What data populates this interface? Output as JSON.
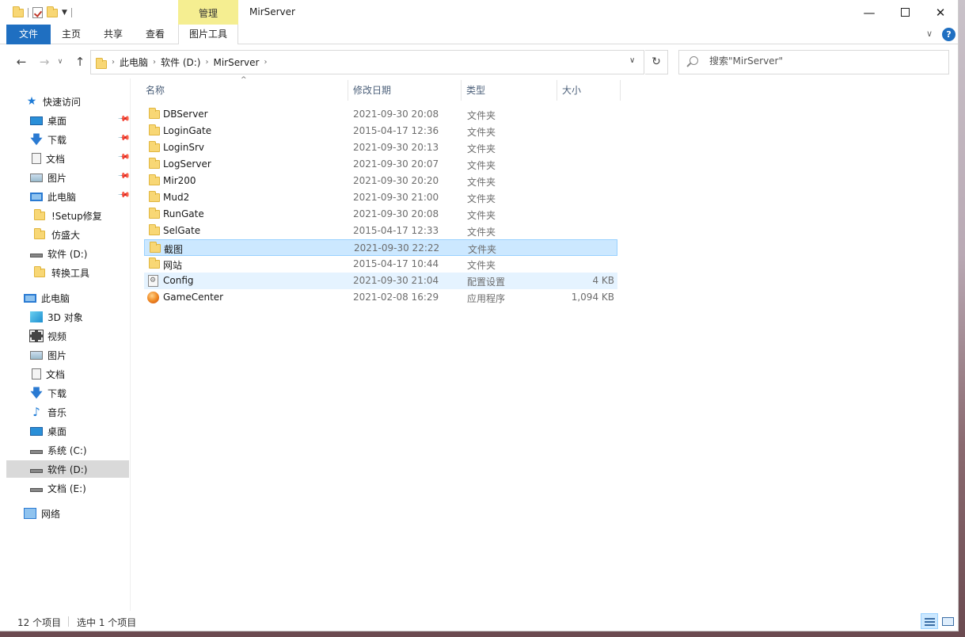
{
  "window": {
    "title": "MirServer",
    "context_tab_header": "管理",
    "minimize_glyph": "—",
    "close_glyph": "✕"
  },
  "ribbon": {
    "tabs": [
      "文件",
      "主页",
      "共享",
      "查看",
      "图片工具"
    ],
    "expand_glyph": "∨",
    "help_glyph": "?"
  },
  "address": {
    "crumbs": [
      "此电脑",
      "软件 (D:)",
      "MirServer"
    ],
    "search_placeholder": "搜索\"MirServer\"",
    "refresh_glyph": "↻"
  },
  "nav": {
    "quick_access": "快速访问",
    "quick_items": [
      {
        "label": "桌面",
        "icon": "desktop-icon",
        "pinned": true
      },
      {
        "label": "下载",
        "icon": "download-icon",
        "pinned": true
      },
      {
        "label": "文档",
        "icon": "document-icon",
        "pinned": true
      },
      {
        "label": "图片",
        "icon": "picture-icon",
        "pinned": true
      },
      {
        "label": "此电脑",
        "icon": "computer-icon",
        "pinned": true
      },
      {
        "label": "!Setup修复",
        "icon": "folder-icon",
        "pinned": false
      },
      {
        "label": "仿盛大",
        "icon": "folder-icon",
        "pinned": false
      },
      {
        "label": "软件 (D:)",
        "icon": "drive-icon",
        "pinned": false
      },
      {
        "label": "转换工具",
        "icon": "folder-icon",
        "pinned": false
      }
    ],
    "this_pc": "此电脑",
    "pc_items": [
      {
        "label": "3D 对象",
        "icon": "3d-objects-icon"
      },
      {
        "label": "视频",
        "icon": "video-icon"
      },
      {
        "label": "图片",
        "icon": "picture-icon"
      },
      {
        "label": "文档",
        "icon": "document-icon"
      },
      {
        "label": "下载",
        "icon": "download-icon"
      },
      {
        "label": "音乐",
        "icon": "music-icon"
      },
      {
        "label": "桌面",
        "icon": "desktop-icon"
      },
      {
        "label": "系统 (C:)",
        "icon": "system-drive-icon"
      },
      {
        "label": "软件 (D:)",
        "icon": "drive-icon"
      },
      {
        "label": "文档 (E:)",
        "icon": "drive-icon"
      }
    ],
    "network": "网络"
  },
  "columns": [
    "名称",
    "修改日期",
    "类型",
    "大小"
  ],
  "files": [
    {
      "name": "DBServer",
      "date": "2021-09-30 20:08",
      "type": "文件夹",
      "size": "",
      "icon": "folder-icon"
    },
    {
      "name": "LoginGate",
      "date": "2015-04-17 12:36",
      "type": "文件夹",
      "size": "",
      "icon": "folder-icon"
    },
    {
      "name": "LoginSrv",
      "date": "2021-09-30 20:13",
      "type": "文件夹",
      "size": "",
      "icon": "folder-icon"
    },
    {
      "name": "LogServer",
      "date": "2021-09-30 20:07",
      "type": "文件夹",
      "size": "",
      "icon": "folder-icon"
    },
    {
      "name": "Mir200",
      "date": "2021-09-30 20:20",
      "type": "文件夹",
      "size": "",
      "icon": "folder-icon"
    },
    {
      "name": "Mud2",
      "date": "2021-09-30 21:00",
      "type": "文件夹",
      "size": "",
      "icon": "folder-icon"
    },
    {
      "name": "RunGate",
      "date": "2021-09-30 20:08",
      "type": "文件夹",
      "size": "",
      "icon": "folder-icon"
    },
    {
      "name": "SelGate",
      "date": "2015-04-17 12:33",
      "type": "文件夹",
      "size": "",
      "icon": "folder-icon"
    },
    {
      "name": "截图",
      "date": "2021-09-30 22:22",
      "type": "文件夹",
      "size": "",
      "icon": "folder-icon",
      "selected": true
    },
    {
      "name": "网站",
      "date": "2015-04-17 10:44",
      "type": "文件夹",
      "size": "",
      "icon": "folder-icon"
    },
    {
      "name": "Config",
      "date": "2021-09-30 21:04",
      "type": "配置设置",
      "size": "4 KB",
      "icon": "config-file-icon",
      "hover": true
    },
    {
      "name": "GameCenter",
      "date": "2021-02-08 16:29",
      "type": "应用程序",
      "size": "1,094 KB",
      "icon": "application-icon"
    }
  ],
  "status": {
    "item_count": "12 个项目",
    "selected_count": "选中 1 个项目"
  },
  "colors": {
    "accent": "#1f6fc1",
    "selection_bg": "#cce8ff",
    "selection_border": "#99d1ff",
    "context_tab": "#f5ee91",
    "folder": "#f8d775"
  }
}
